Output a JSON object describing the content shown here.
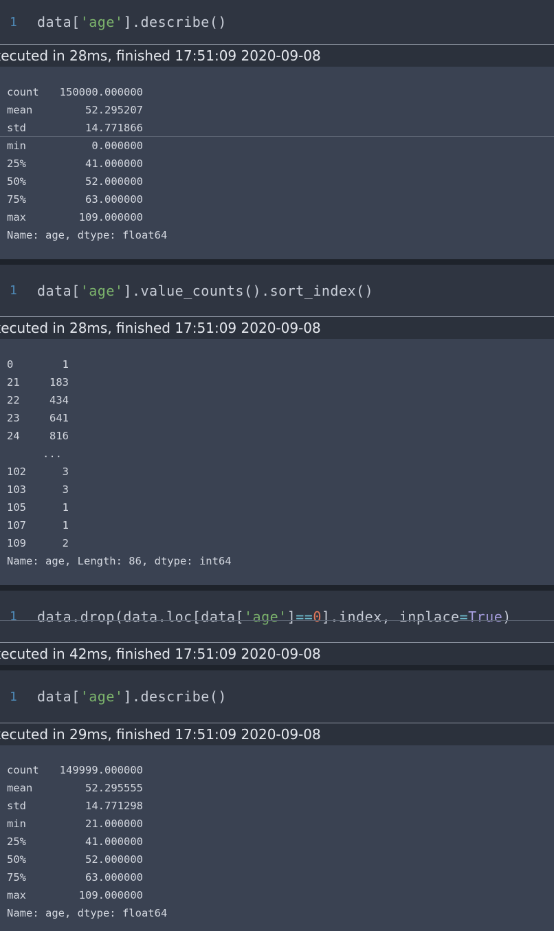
{
  "cells": [
    {
      "line_no": "1",
      "code": [
        {
          "t": "data[",
          "c": "plain"
        },
        {
          "t": "'age'",
          "c": "str"
        },
        {
          "t": "].describe()",
          "c": "plain"
        }
      ],
      "exec_text": "xecuted in 28ms, finished 17:51:09 2020-09-08",
      "output": [
        [
          "count",
          "150000.000000"
        ],
        [
          "mean",
          "52.295207"
        ],
        [
          "std",
          "14.771866"
        ],
        [
          "min",
          "0.000000"
        ],
        [
          "25%",
          "41.000000"
        ],
        [
          "50%",
          "52.000000"
        ],
        [
          "75%",
          "63.000000"
        ],
        [
          "max",
          "109.000000"
        ]
      ],
      "footer": "Name: age, dtype: float64"
    },
    {
      "line_no": "1",
      "code": [
        {
          "t": "data[",
          "c": "plain"
        },
        {
          "t": "'age'",
          "c": "str"
        },
        {
          "t": "].value_counts().sort_index()",
          "c": "plain"
        }
      ],
      "exec_text": "xecuted in 28ms, finished 17:51:09 2020-09-08",
      "output": [
        [
          "0",
          "1"
        ],
        [
          "21",
          "183"
        ],
        [
          "22",
          "434"
        ],
        [
          "23",
          "641"
        ],
        [
          "24",
          "816"
        ],
        [
          "",
          "..."
        ],
        [
          "102",
          "3"
        ],
        [
          "103",
          "3"
        ],
        [
          "105",
          "1"
        ],
        [
          "107",
          "1"
        ],
        [
          "109",
          "2"
        ]
      ],
      "footer": "Name: age, Length: 86, dtype: int64"
    },
    {
      "line_no": "1",
      "code": [
        {
          "t": "data.drop(data.loc[data[",
          "c": "plain"
        },
        {
          "t": "'age'",
          "c": "str"
        },
        {
          "t": "]",
          "c": "plain"
        },
        {
          "t": "==",
          "c": "op"
        },
        {
          "t": "0",
          "c": "num"
        },
        {
          "t": "].index, inplace",
          "c": "plain"
        },
        {
          "t": "=",
          "c": "op"
        },
        {
          "t": "True",
          "c": "kw"
        },
        {
          "t": ")",
          "c": "plain"
        }
      ],
      "exec_text": "xecuted in 42ms, finished 17:51:09 2020-09-08"
    },
    {
      "line_no": "1",
      "code": [
        {
          "t": "data[",
          "c": "plain"
        },
        {
          "t": "'age'",
          "c": "str"
        },
        {
          "t": "].describe()",
          "c": "plain"
        }
      ],
      "exec_text": "xecuted in 29ms, finished 17:51:09 2020-09-08",
      "output": [
        [
          "count",
          "149999.000000"
        ],
        [
          "mean",
          "52.295555"
        ],
        [
          "std",
          "14.771298"
        ],
        [
          "min",
          "21.000000"
        ],
        [
          "25%",
          "41.000000"
        ],
        [
          "50%",
          "52.000000"
        ],
        [
          "75%",
          "63.000000"
        ],
        [
          "max",
          "109.000000"
        ]
      ],
      "footer": "Name: age, dtype: float64"
    }
  ]
}
